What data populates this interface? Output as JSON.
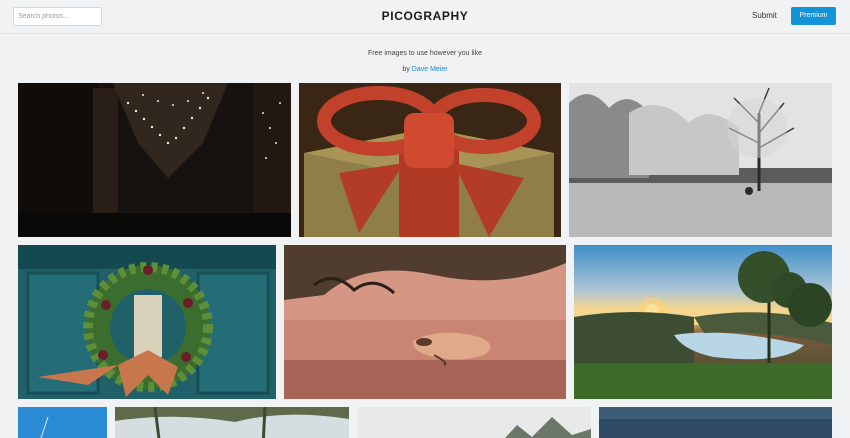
{
  "header": {
    "search_placeholder": "Search photos...",
    "brand": "PICOGRAPHY",
    "submit_label": "Submit",
    "premium_label": "Premium"
  },
  "intro": {
    "tagline": "Free images to use however you like",
    "by_prefix": "by",
    "author": "Dave Meier"
  },
  "colors": {
    "accent": "#1493d9",
    "link": "#1e88cf",
    "background": "#f1f2f3"
  },
  "gallery": {
    "photos": [
      {
        "subject": "string lights in dark alley"
      },
      {
        "subject": "red glitter gift bow"
      },
      {
        "subject": "snowy trees by river"
      },
      {
        "subject": "christmas wreath on teal door"
      },
      {
        "subject": "floating leaf on pink water"
      },
      {
        "subject": "sunset over river valley"
      },
      {
        "subject": "blue sky"
      },
      {
        "subject": "forest trees"
      },
      {
        "subject": "misty treetops"
      },
      {
        "subject": "dark blue water"
      }
    ]
  }
}
